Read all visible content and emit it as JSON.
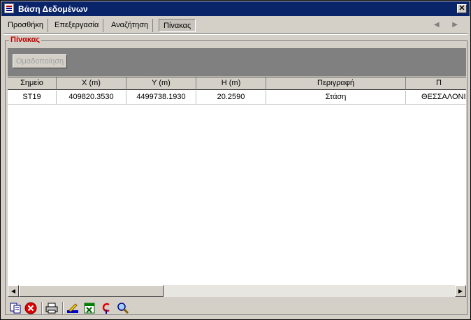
{
  "window": {
    "title": "Βάση Δεδομένων",
    "close_glyph": "✕"
  },
  "tabs": [
    {
      "label": "Προσθήκη",
      "active": false
    },
    {
      "label": "Επεξεργασία",
      "active": false
    },
    {
      "label": "Αναζήτηση",
      "active": false
    },
    {
      "label": "Πίνακας",
      "active": true
    }
  ],
  "tab_arrows": "◀ ▶",
  "group": {
    "label": "Πίνακας",
    "group_button": "Ομαδοποίηση"
  },
  "table": {
    "headers": [
      "Σημείο",
      "X (m)",
      "Y (m)",
      "H (m)",
      "Περιγραφή",
      "Π"
    ],
    "rows": [
      [
        "ST19",
        "409820.3530",
        "4499738.1930",
        "20.2590",
        "Στάση",
        "ΘΕΣΣΑΛΟΝΙΚ"
      ]
    ]
  },
  "scrollbar": {
    "left_arrow": "◀",
    "right_arrow": "▶"
  },
  "toolbar": {
    "icons": [
      "copy-icon",
      "delete-icon",
      "print-icon",
      "edit-icon",
      "excel-icon",
      "coordinate-icon",
      "search-icon"
    ]
  },
  "colors": {
    "titlebar": "#0a246a",
    "group_label": "#c00000",
    "face": "#d4d0c8"
  }
}
